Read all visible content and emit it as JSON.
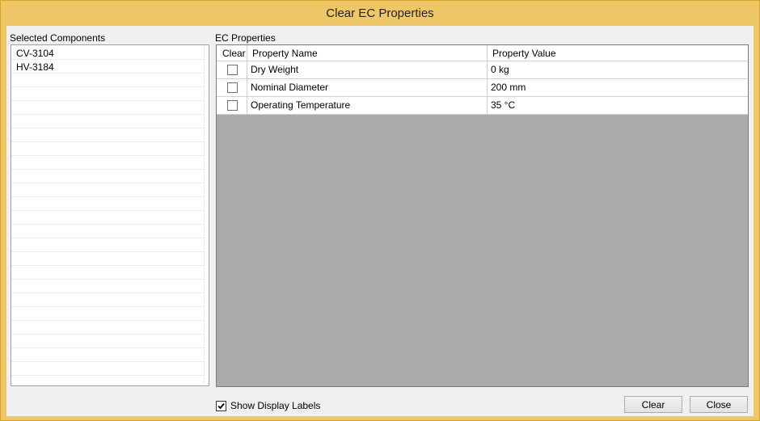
{
  "window": {
    "title": "Clear EC Properties"
  },
  "left": {
    "label": "Selected Components",
    "items": [
      "CV-3104",
      "HV-3184"
    ]
  },
  "grid": {
    "label": "EC Properties",
    "columns": [
      "Clear",
      "Property Name",
      "Property Value"
    ],
    "rows": [
      {
        "clear": false,
        "name": "Dry Weight",
        "value": "0 kg"
      },
      {
        "clear": false,
        "name": "Nominal Diameter",
        "value": "200 mm"
      },
      {
        "clear": false,
        "name": "Operating Temperature",
        "value": "35 °C"
      }
    ]
  },
  "footer": {
    "show_display_labels": {
      "label": "Show Display Labels",
      "checked": true
    },
    "clear_button": "Clear",
    "close_button": "Close"
  },
  "colors": {
    "titlebar": "#f0c766",
    "client": "#f0f0f0",
    "grid_empty": "#ababab"
  }
}
